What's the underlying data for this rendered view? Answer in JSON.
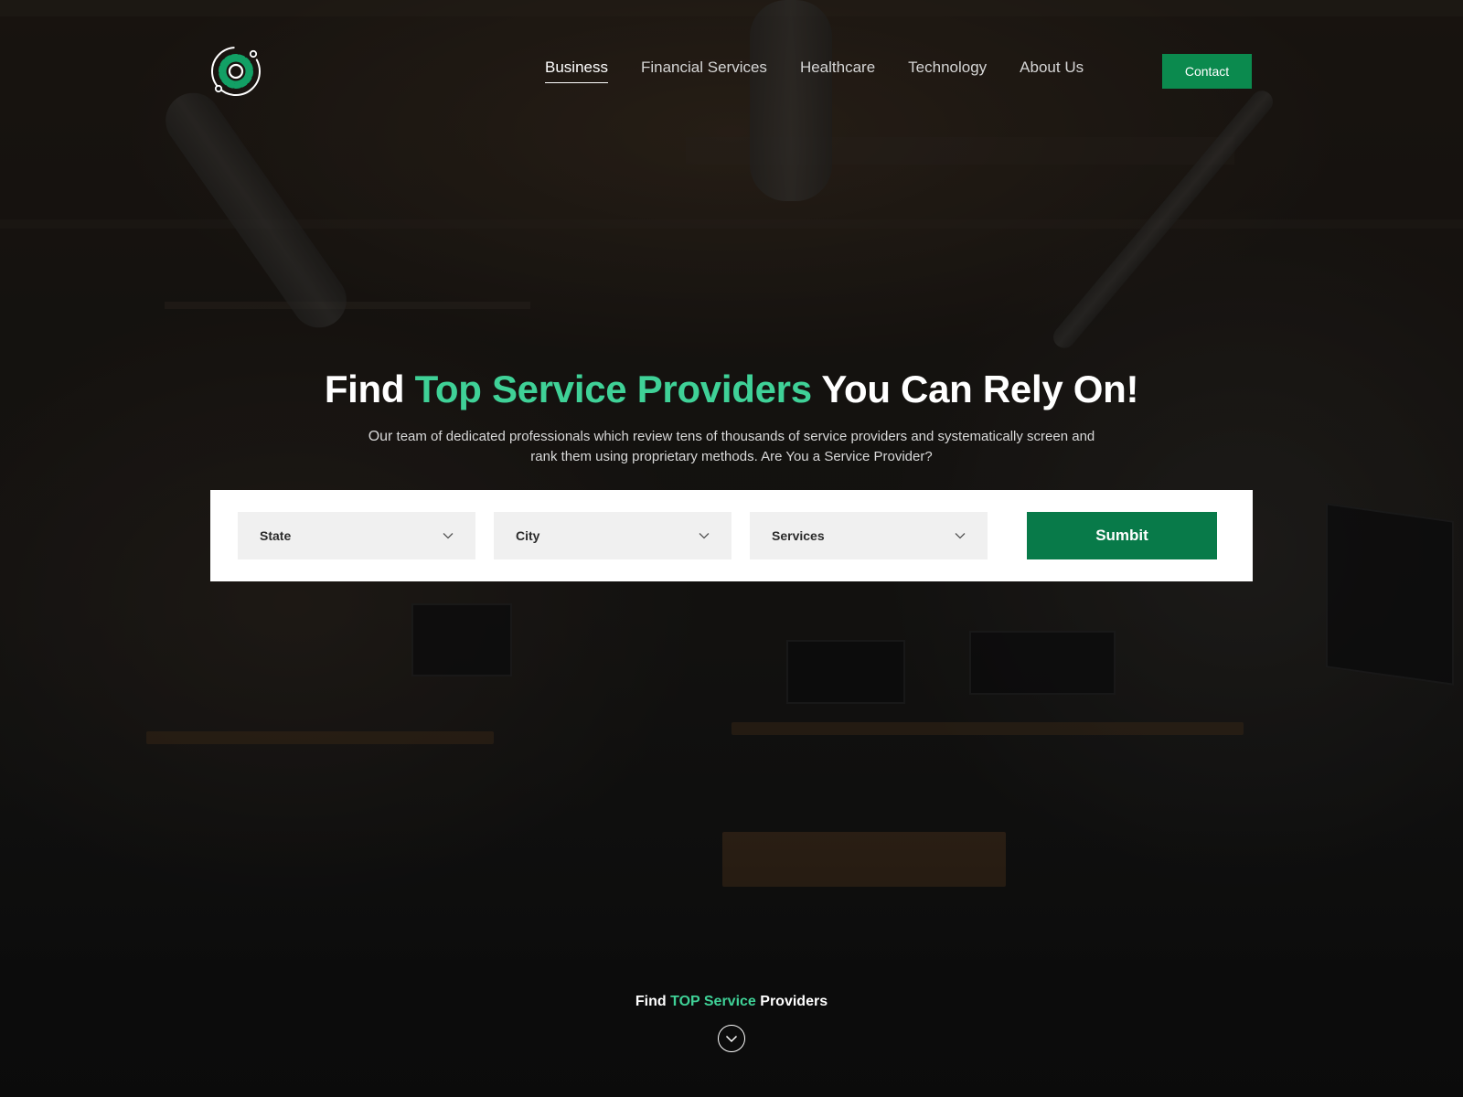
{
  "nav": {
    "items": [
      {
        "label": "Business",
        "active": true
      },
      {
        "label": "Financial Services",
        "active": false
      },
      {
        "label": "Healthcare",
        "active": false
      },
      {
        "label": "Technology",
        "active": false
      },
      {
        "label": "About Us",
        "active": false
      }
    ],
    "contact_label": "Contact"
  },
  "hero": {
    "title_part1": "Find",
    "title_accent": "Top Service Providers",
    "title_part2": "You Can Rely On!",
    "subtitle_lead": "Our",
    "subtitle_rest": "team of dedicated professionals which review tens of thousands of service providers  and systematically screen and rank them using proprietary methods. Are You a Service Provider?"
  },
  "search": {
    "state_label": "State",
    "city_label": "City",
    "services_label": "Services",
    "submit_label": "Sumbit"
  },
  "bottom": {
    "prefix": "Find",
    "accent": "TOP Service",
    "suffix": "Providers"
  },
  "colors": {
    "accent_green": "#3fd197",
    "button_green": "#087a49",
    "contact_green": "#0b8a4e"
  },
  "icons": {
    "logo": "gear-orbit-logo",
    "dropdown": "chevron-down-icon",
    "scroll": "circle-chevron-down-icon"
  }
}
